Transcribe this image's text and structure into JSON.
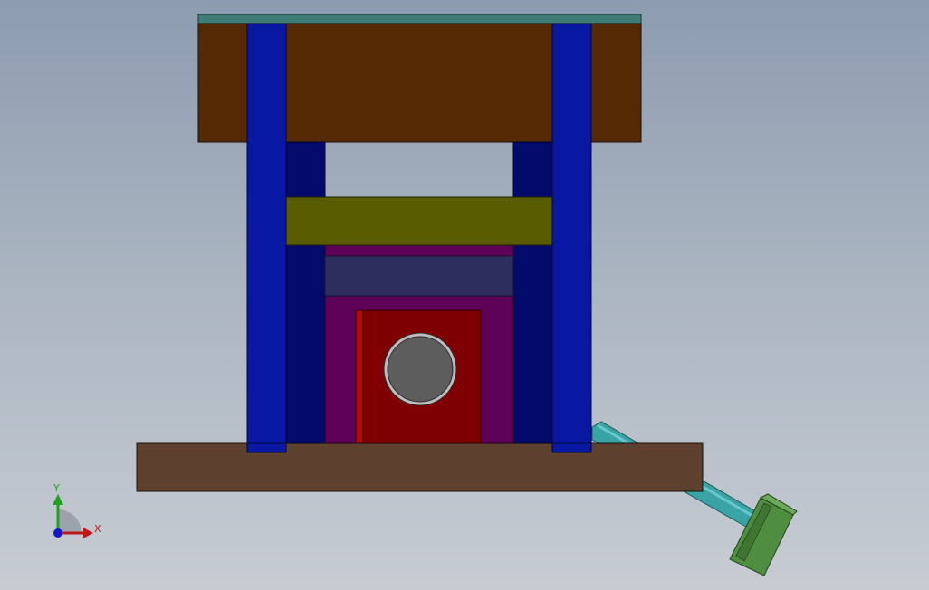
{
  "view": {
    "background_top": "#8d9cb0",
    "background_bottom": "#c7ccd3"
  },
  "triad": {
    "x_label": "X",
    "y_label": "Y",
    "x_color": "#c0181a",
    "y_color": "#1fa31f",
    "z_color": "#1616c8"
  },
  "parts": {
    "top_plate_color": "#542903",
    "top_plate_edge_color": "#3e7c78",
    "guide_pillar_color": "#0818a2",
    "guide_bushing_color": "#040a6c",
    "upper_pad_color": "#5a5c02",
    "stripper_color": "#2d2e5e",
    "die_holder_color": "#5e0258",
    "die_insert_color": "#7f0003",
    "die_insert_edge_color": "#b00a0a",
    "punch_color": "#5d5d5d",
    "base_plate_color": "#5d412e",
    "cylinder_rod_color": "#3aa3a6",
    "cylinder_cap_color": "#4f8d40"
  }
}
